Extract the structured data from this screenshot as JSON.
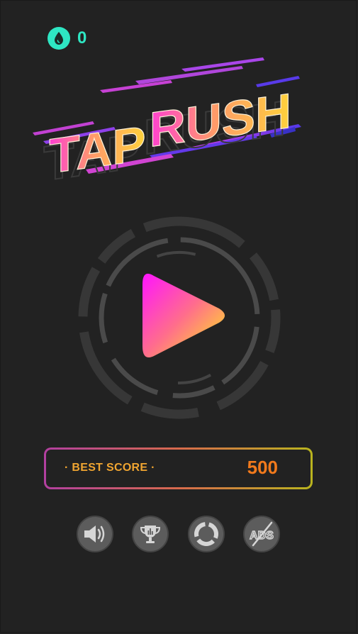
{
  "currency": {
    "icon": "drop-icon",
    "count": "0",
    "color": "#2ee6c3"
  },
  "logo": {
    "word1": "TAP",
    "word2": "RUSH"
  },
  "play": {
    "icon": "play-icon"
  },
  "best_score": {
    "label": "· BEST SCORE ·",
    "value": "500"
  },
  "buttons": [
    {
      "name": "sound-button",
      "icon": "speaker-icon"
    },
    {
      "name": "leaderboard-button",
      "icon": "trophy-icon"
    },
    {
      "name": "more-games-button",
      "icon": "segmented-circle-icon"
    },
    {
      "name": "remove-ads-button",
      "icon": "ads-off-icon",
      "text": "ADS"
    }
  ],
  "colors": {
    "background": "#222222",
    "accent_teal": "#2ee6c3",
    "score_orange": "#f27a1c",
    "label_gold": "#f0a531",
    "play_gradient_start": "#ff14ff",
    "play_gradient_end": "#ffee1a"
  }
}
